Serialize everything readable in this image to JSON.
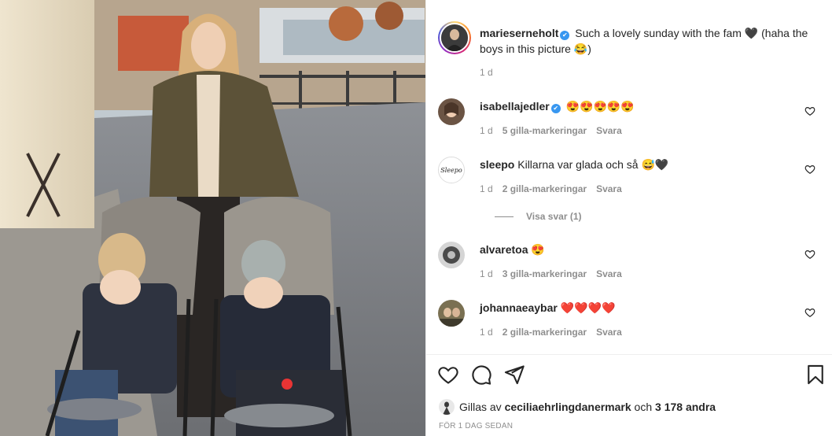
{
  "caption": {
    "username": "marieserneholt",
    "text": "Such a lovely sunday with the fam 🖤 (haha the boys in this picture 😂)",
    "time": "1 d"
  },
  "comments": [
    {
      "username": "isabellajedler",
      "verified": true,
      "text": "😍😍😍😍😍",
      "time": "1 d",
      "likes": "5 gilla-markeringar",
      "reply": "Svara"
    },
    {
      "username": "sleepo",
      "verified": false,
      "text": "Killarna var glada och så 😅🖤",
      "time": "1 d",
      "likes": "2 gilla-markeringar",
      "reply": "Svara",
      "view_replies": "Visa svar (1)"
    },
    {
      "username": "alvaretoa",
      "verified": false,
      "text": "😍",
      "time": "1 d",
      "likes": "3 gilla-markeringar",
      "reply": "Svara"
    },
    {
      "username": "johannaeaybar",
      "verified": false,
      "text": "❤️❤️❤️❤️",
      "time": "1 d",
      "likes": "2 gilla-markeringar",
      "reply": "Svara"
    }
  ],
  "likes_line": {
    "prefix": "Gillas av",
    "liker": "ceciliaehrlingdanermark",
    "connector": "och",
    "others": "3 178 andra"
  },
  "timestamp": "För 1 dag sedan",
  "sleepo_logo_text": "Sleepo",
  "colors": {
    "verified": "#3897f0",
    "meta": "#8e8e8e",
    "text": "#262626"
  }
}
